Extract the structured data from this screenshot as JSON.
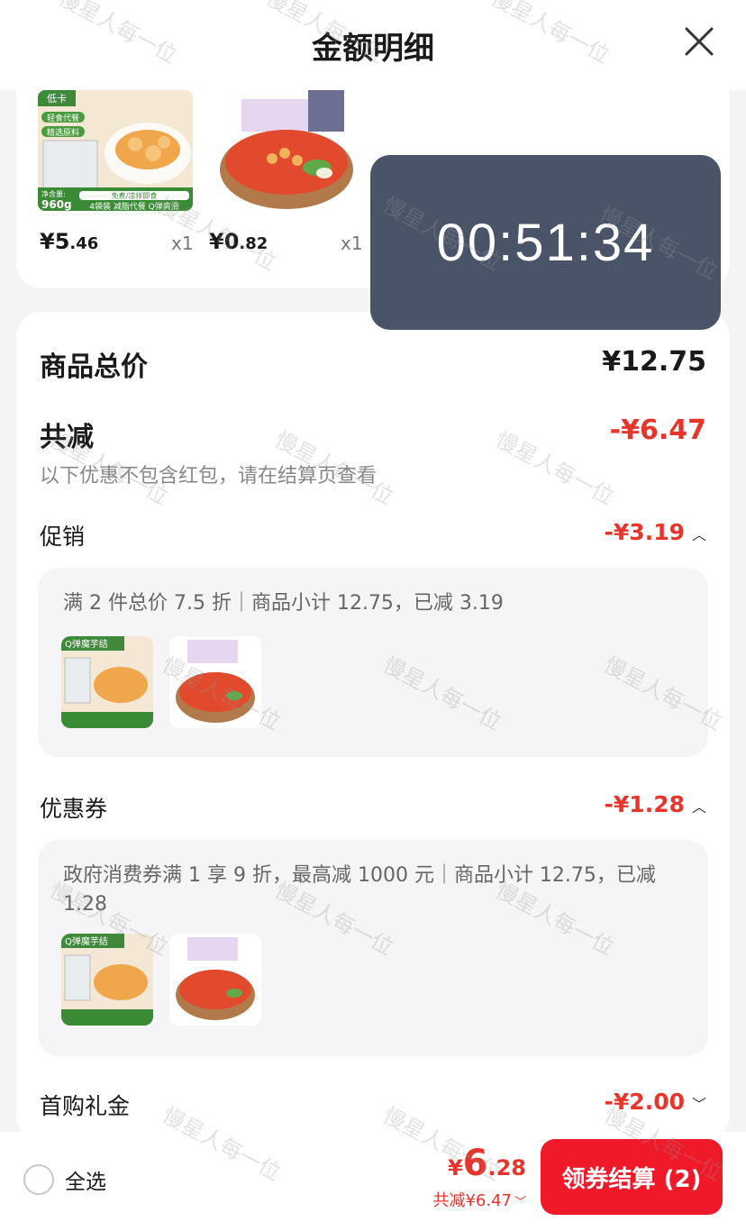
{
  "header": {
    "title": "金额明细"
  },
  "products": [
    {
      "price_int": "¥5",
      "price_dec": ".46",
      "qty": "x1"
    },
    {
      "price_int": "¥0",
      "price_dec": ".82",
      "qty": "x1"
    }
  ],
  "product_art": {
    "p1_tag": "低卡",
    "p1_badge1": "轻食代餐",
    "p1_badge2": "精选原料",
    "p1_net": "净含量:",
    "p1_weight": "960g",
    "p1_banner_top": "免煮/凉拌即食",
    "p1_banner": "4袋装 减脂代餐 Q弹爽滑"
  },
  "timer": {
    "text": "00:51:34"
  },
  "summary": {
    "total_label": "商品总价",
    "total_value": "¥12.75",
    "discount_label": "共减",
    "discount_value": "-¥6.47",
    "note": "以下优惠不包含红包，请在结算页查看"
  },
  "promo": {
    "label": "促销",
    "value": "-¥3.19",
    "desc": "满 2 件总价 7.5 折｜商品小计 12.75，已减 3.19",
    "thumb_title": "Q弹魔芋结"
  },
  "coupon": {
    "label": "优惠券",
    "value": "-¥1.28",
    "desc": "政府消费券满 1 享 9 折，最高减 1000 元｜商品小计 12.75，已减 1.28",
    "thumb_title": "Q弹魔芋结"
  },
  "first_gift": {
    "label": "首购礼金",
    "value": "-¥2.00"
  },
  "bottom": {
    "select_all": "全选",
    "price_symbol": "¥",
    "price_int": "6",
    "price_dec": ".28",
    "saved": "共减¥6.47",
    "checkout": "领券结算 (2)"
  },
  "watermark": "慢星人每一位",
  "colors": {
    "accent_red": "#e8352b",
    "button_red": "#f0192a",
    "timer_bg": "#4a5468"
  },
  "icons": [
    "close-icon",
    "chevron-up-icon",
    "chevron-down-icon",
    "radio-icon"
  ]
}
